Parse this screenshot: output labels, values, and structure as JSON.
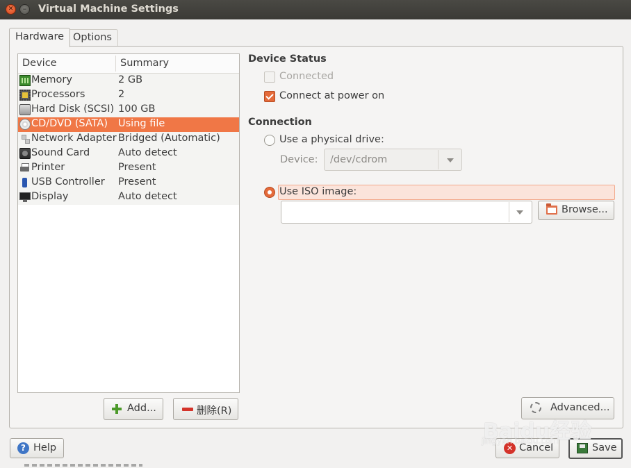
{
  "window": {
    "title": "Virtual Machine Settings"
  },
  "tabs": [
    {
      "label": "Hardware",
      "active": true
    },
    {
      "label": "Options",
      "active": false
    }
  ],
  "device_list": {
    "columns": [
      "Device",
      "Summary"
    ],
    "rows": [
      {
        "icon": "memory-icon",
        "device": "Memory",
        "summary": "2 GB"
      },
      {
        "icon": "processor-icon",
        "device": "Processors",
        "summary": "2"
      },
      {
        "icon": "hard-disk-icon",
        "device": "Hard Disk (SCSI)",
        "summary": "100 GB"
      },
      {
        "icon": "cd-dvd-icon",
        "device": "CD/DVD (SATA)",
        "summary": "Using file",
        "selected": true
      },
      {
        "icon": "network-adapter-icon",
        "device": "Network Adapter",
        "summary": "Bridged (Automatic)"
      },
      {
        "icon": "sound-card-icon",
        "device": "Sound Card",
        "summary": "Auto detect"
      },
      {
        "icon": "printer-icon",
        "device": "Printer",
        "summary": "Present"
      },
      {
        "icon": "usb-icon",
        "device": "USB Controller",
        "summary": "Present"
      },
      {
        "icon": "display-icon",
        "device": "Display",
        "summary": "Auto detect"
      }
    ],
    "add_label": "Add...",
    "remove_label": "删除(R)"
  },
  "device_status": {
    "heading": "Device Status",
    "connected_label": "Connected",
    "connected_checked": false,
    "connected_enabled": false,
    "power_on_label": "Connect at power on",
    "power_on_checked": true
  },
  "connection": {
    "heading": "Connection",
    "physical_label": "Use a physical drive:",
    "physical_selected": false,
    "device_label": "Device:",
    "device_value": "/dev/cdrom",
    "iso_label": "Use ISO image:",
    "iso_selected": true,
    "iso_path": "",
    "browse_label": "Browse..."
  },
  "buttons": {
    "advanced": "Advanced...",
    "help": "Help",
    "cancel": "Cancel",
    "save": "Save"
  },
  "watermark": {
    "text": "Baidu经验",
    "sub": "jingyan.baidu.com"
  },
  "colors": {
    "accent": "#f07746",
    "titlebar": "#3c3b37"
  }
}
